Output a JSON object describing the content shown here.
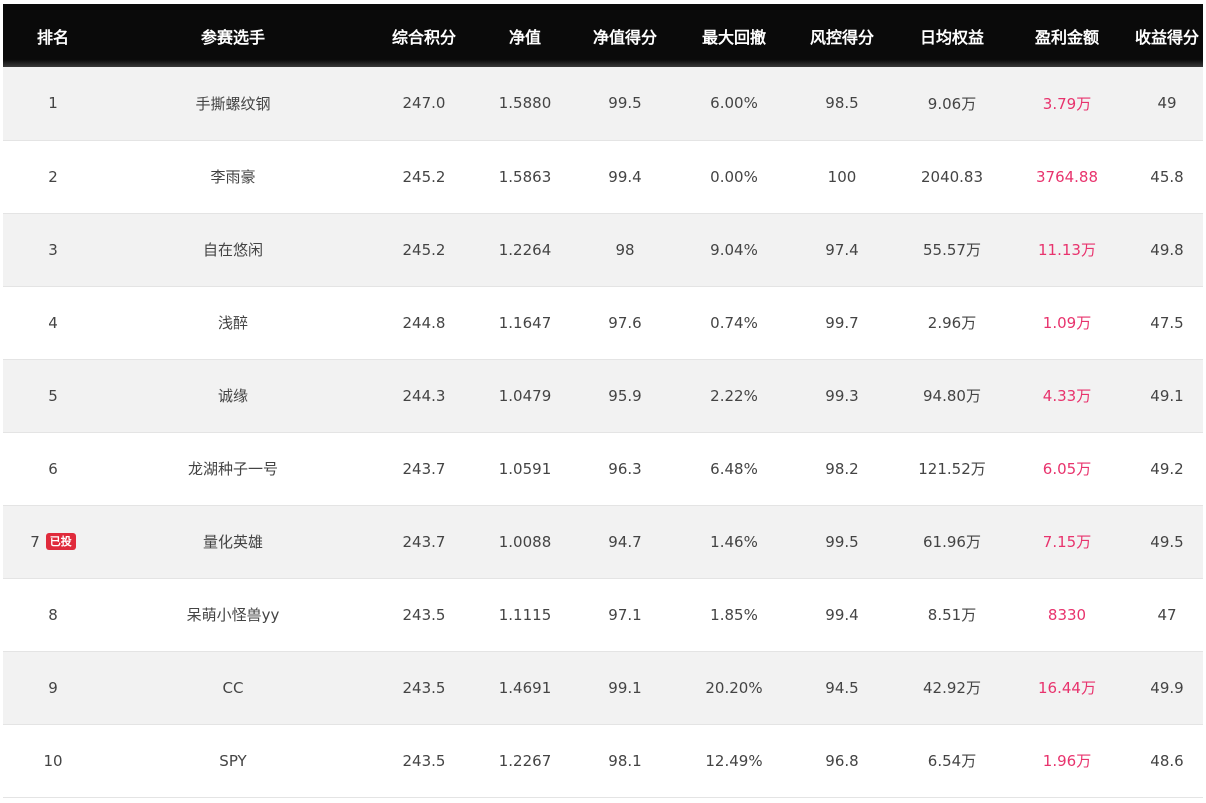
{
  "colors": {
    "header_bg": "#0a0a0a",
    "header_text": "#ffffff",
    "row_odd_bg": "#f2f2f2",
    "row_even_bg": "#ffffff",
    "text": "#444444",
    "profit_text": "#e8336d",
    "badge_bg": "#e02b3c"
  },
  "columns": [
    "排名",
    "参赛选手",
    "综合积分",
    "净值",
    "净值得分",
    "最大回撤",
    "风控得分",
    "日均权益",
    "盈利金额",
    "收益得分"
  ],
  "rows": [
    {
      "rank": "1",
      "badge": "",
      "player": "手撕螺纹钢",
      "score": "247.0",
      "nav": "1.5880",
      "nav_score": "99.5",
      "max_drawdown": "6.00%",
      "risk_score": "98.5",
      "avg_equity": "9.06万",
      "profit": "3.79万",
      "return_score": "49"
    },
    {
      "rank": "2",
      "badge": "",
      "player": "李雨豪",
      "score": "245.2",
      "nav": "1.5863",
      "nav_score": "99.4",
      "max_drawdown": "0.00%",
      "risk_score": "100",
      "avg_equity": "2040.83",
      "profit": "3764.88",
      "return_score": "45.8"
    },
    {
      "rank": "3",
      "badge": "",
      "player": "自在悠闲",
      "score": "245.2",
      "nav": "1.2264",
      "nav_score": "98",
      "max_drawdown": "9.04%",
      "risk_score": "97.4",
      "avg_equity": "55.57万",
      "profit": "11.13万",
      "return_score": "49.8"
    },
    {
      "rank": "4",
      "badge": "",
      "player": "浅醉",
      "score": "244.8",
      "nav": "1.1647",
      "nav_score": "97.6",
      "max_drawdown": "0.74%",
      "risk_score": "99.7",
      "avg_equity": "2.96万",
      "profit": "1.09万",
      "return_score": "47.5"
    },
    {
      "rank": "5",
      "badge": "",
      "player": "诚缘",
      "score": "244.3",
      "nav": "1.0479",
      "nav_score": "95.9",
      "max_drawdown": "2.22%",
      "risk_score": "99.3",
      "avg_equity": "94.80万",
      "profit": "4.33万",
      "return_score": "49.1"
    },
    {
      "rank": "6",
      "badge": "",
      "player": "龙湖种子一号",
      "score": "243.7",
      "nav": "1.0591",
      "nav_score": "96.3",
      "max_drawdown": "6.48%",
      "risk_score": "98.2",
      "avg_equity": "121.52万",
      "profit": "6.05万",
      "return_score": "49.2"
    },
    {
      "rank": "7",
      "badge": "已投",
      "player": "量化英雄",
      "score": "243.7",
      "nav": "1.0088",
      "nav_score": "94.7",
      "max_drawdown": "1.46%",
      "risk_score": "99.5",
      "avg_equity": "61.96万",
      "profit": "7.15万",
      "return_score": "49.5"
    },
    {
      "rank": "8",
      "badge": "",
      "player": "呆萌小怪兽yy",
      "score": "243.5",
      "nav": "1.1115",
      "nav_score": "97.1",
      "max_drawdown": "1.85%",
      "risk_score": "99.4",
      "avg_equity": "8.51万",
      "profit": "8330",
      "return_score": "47"
    },
    {
      "rank": "9",
      "badge": "",
      "player": "CC",
      "score": "243.5",
      "nav": "1.4691",
      "nav_score": "99.1",
      "max_drawdown": "20.20%",
      "risk_score": "94.5",
      "avg_equity": "42.92万",
      "profit": "16.44万",
      "return_score": "49.9"
    },
    {
      "rank": "10",
      "badge": "",
      "player": "SPY",
      "score": "243.5",
      "nav": "1.2267",
      "nav_score": "98.1",
      "max_drawdown": "12.49%",
      "risk_score": "96.8",
      "avg_equity": "6.54万",
      "profit": "1.96万",
      "return_score": "48.6"
    }
  ]
}
